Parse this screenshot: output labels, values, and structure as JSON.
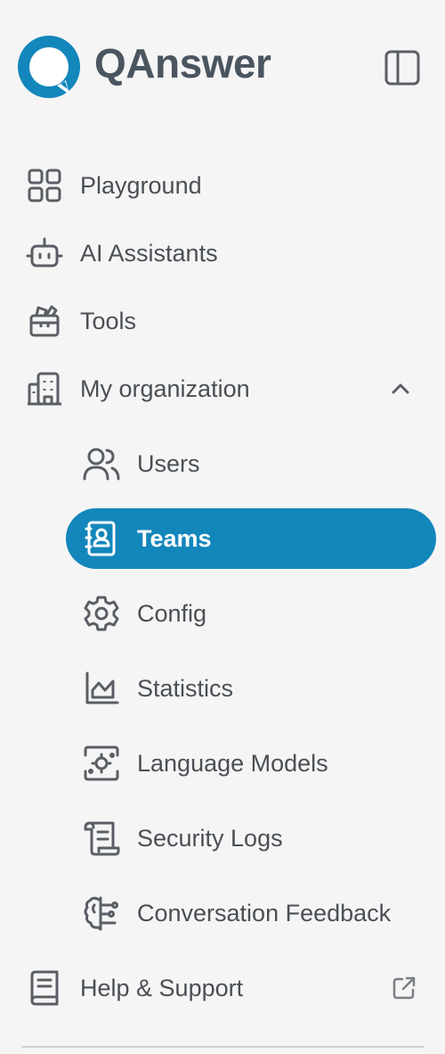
{
  "brand": {
    "name": "QAnswer"
  },
  "colors": {
    "accent": "#1386bb",
    "text": "#4a4f55",
    "background": "#f5f5f5"
  },
  "nav": {
    "playground": {
      "label": "Playground",
      "icon": "grid-icon"
    },
    "ai_assistants": {
      "label": "AI Assistants",
      "icon": "robot-icon"
    },
    "tools": {
      "label": "Tools",
      "icon": "toolbox-icon"
    },
    "my_organization": {
      "label": "My organization",
      "icon": "building-icon",
      "expanded": true,
      "children": {
        "users": {
          "label": "Users",
          "icon": "users-icon"
        },
        "teams": {
          "label": "Teams",
          "icon": "contact-book-icon",
          "active": true
        },
        "config": {
          "label": "Config",
          "icon": "gear-icon"
        },
        "statistics": {
          "label": "Statistics",
          "icon": "chart-icon"
        },
        "language_models": {
          "label": "Language Models",
          "icon": "ai-chip-icon"
        },
        "security_logs": {
          "label": "Security Logs",
          "icon": "scroll-icon"
        },
        "conversation_feedback": {
          "label": "Conversation Feedback",
          "icon": "brain-icon"
        }
      }
    },
    "help_support": {
      "label": "Help & Support",
      "icon": "book-icon",
      "external": true
    }
  }
}
